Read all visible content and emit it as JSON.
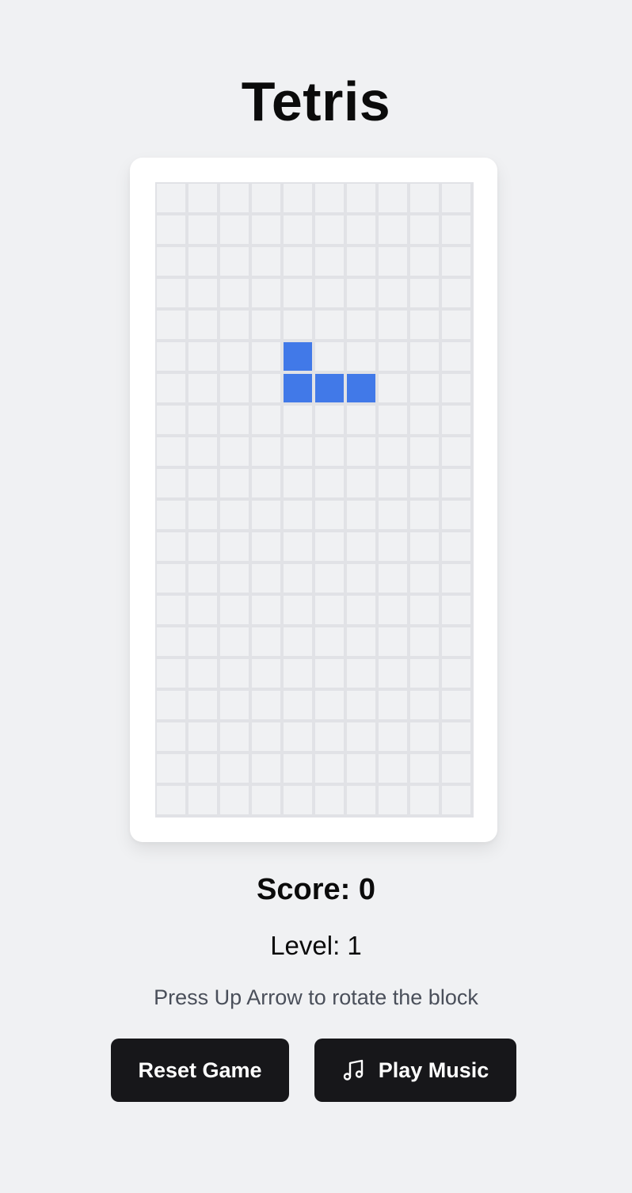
{
  "title": "Tetris",
  "board": {
    "columns": 10,
    "rows": 20,
    "active_piece": {
      "color": "#4179e8",
      "cells": [
        [
          4,
          5
        ],
        [
          4,
          6
        ],
        [
          5,
          6
        ],
        [
          6,
          6
        ]
      ]
    }
  },
  "stats": {
    "score_text": "Score: 0",
    "level_text": "Level: 1"
  },
  "hint": "Press Up Arrow to rotate the block",
  "buttons": {
    "reset_label": "Reset Game",
    "music_label": "Play Music",
    "music_icon": "music-note-icon"
  },
  "colors": {
    "background": "#f0f1f3",
    "empty_cell": "#f0f1f3",
    "grid_line": "#e1e2e6",
    "button": "#17171a"
  }
}
